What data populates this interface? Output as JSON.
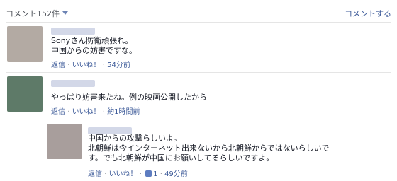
{
  "header": {
    "comment_count": "コメント152件",
    "comment_action": "コメントする"
  },
  "comments": [
    {
      "line1": "Sonyさん防衛頑張れ。",
      "line2": "中国からの妨害ですな。",
      "reply": "返信",
      "like": "いいね！",
      "sep": "·",
      "time": "54分前",
      "avatar_color": "#b3aaa3"
    },
    {
      "line1": "やっぱり妨害来たね。例の映画公開したから",
      "reply": "返信",
      "like": "いいね！",
      "sep": "·",
      "time": "約1時間前",
      "avatar_color": "#5e7a68"
    },
    {
      "line1": "中国からの攻撃らしいよ。",
      "line2": "北朝鮮は今インターネット出来ないから北朝鮮からではないらしいで",
      "line3": "す。でも北朝鮮が中国にお願いしてるらしいですよ。",
      "reply": "返信",
      "like": "いいね！",
      "sep": "·",
      "like_count": "1",
      "time": "49分前",
      "avatar_color": "#a89e9c"
    }
  ]
}
